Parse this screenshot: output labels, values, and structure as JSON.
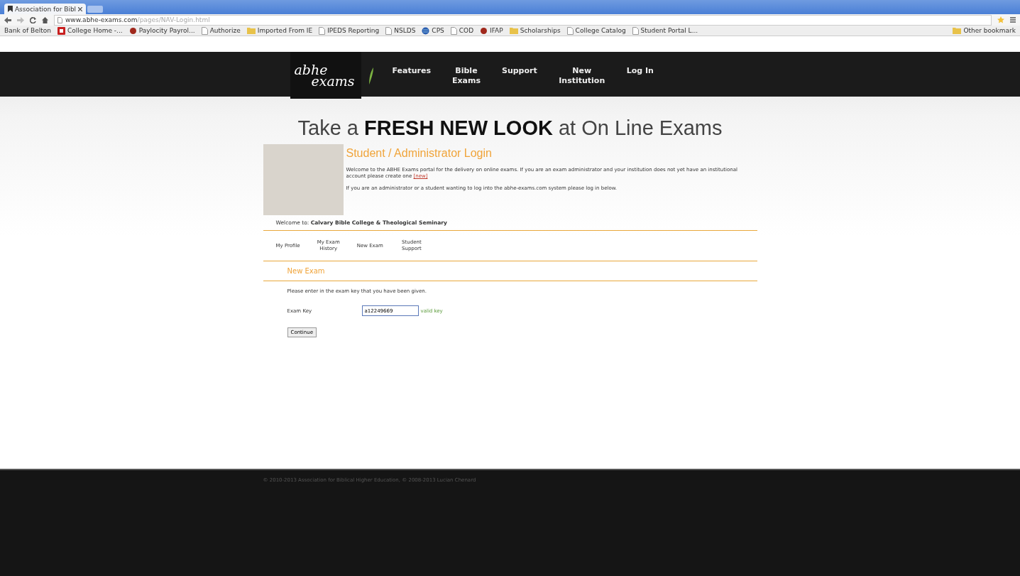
{
  "browser": {
    "tab_title": "Association for Bibl",
    "url_host": "www.abhe-exams.com",
    "url_path": "/pages/NAV-Login.html",
    "bookmarks": [
      {
        "label": "Bank of Belton",
        "kind": "none"
      },
      {
        "label": "College Home -...",
        "kind": "app"
      },
      {
        "label": "Paylocity Payrol...",
        "kind": "site"
      },
      {
        "label": "Authorize",
        "kind": "page"
      },
      {
        "label": "Imported From IE",
        "kind": "folder"
      },
      {
        "label": "IPEDS Reporting",
        "kind": "page"
      },
      {
        "label": "NSLDS",
        "kind": "page"
      },
      {
        "label": "CPS",
        "kind": "globe"
      },
      {
        "label": "COD",
        "kind": "page"
      },
      {
        "label": "IFAP",
        "kind": "site"
      },
      {
        "label": "Scholarships",
        "kind": "folder"
      },
      {
        "label": "College Catalog",
        "kind": "page"
      },
      {
        "label": "Student Portal L...",
        "kind": "page"
      }
    ],
    "other_bookmarks": "Other bookmark"
  },
  "site": {
    "logo": [
      "abhe",
      "exams"
    ],
    "nav": [
      "Features",
      "Bible Exams",
      "Support",
      "New Institution",
      "Log In"
    ]
  },
  "headline": "Take a **FRESH NEW LOOK** at On Line Exams",
  "login": {
    "title": "Student / Administrator Login",
    "intro": "Welcome to the ABHE Exams portal for the delivery on online exams. If you are an exam administrator and your institution does not yet have an institutional account please create one",
    "intro_link": "[new]",
    "note": "If you are an administrator or a student wanting to log into the abhe-exams.com system please log in below."
  },
  "welcome": "Welcome to: **Calvary Bible College & Theological Seminary**",
  "menu": [
    "My Profile",
    "My Exam History",
    "New Exam",
    "Student Support"
  ],
  "section_title": "New Exam",
  "prompt": "Please enter in the exam key that you have been given.",
  "exam_key": {
    "label": "Exam Key",
    "value": "a12249669",
    "status": "valid key"
  },
  "continue_button": "Continue",
  "footer": "© 2010-2013 Association for Biblical Higher Education, © 2008-2013 Lucian Chenard"
}
